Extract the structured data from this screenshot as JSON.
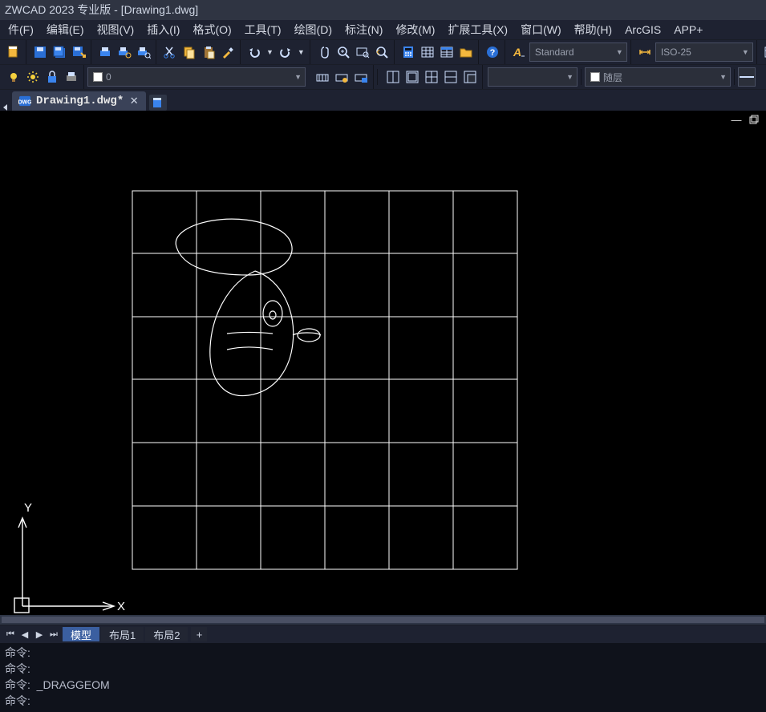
{
  "title": "ZWCAD 2023 专业版 - [Drawing1.dwg]",
  "menu": [
    "件(F)",
    "编辑(E)",
    "视图(V)",
    "插入(I)",
    "格式(O)",
    "工具(T)",
    "绘图(D)",
    "标注(N)",
    "修改(M)",
    "扩展工具(X)",
    "窗口(W)",
    "帮助(H)",
    "ArcGIS",
    "APP+"
  ],
  "textstyle": "Standard",
  "dimstyle": "ISO-25",
  "layer": "0",
  "bylayer": "随层",
  "file_tab": {
    "name": "Drawing1.dwg*"
  },
  "layout_tabs": {
    "active": "模型",
    "others": [
      "布局1",
      "布局2"
    ]
  },
  "cmd_prompt": "命令:",
  "cmd_history": [
    "命令:",
    "命令:",
    "命令:  _DRAGGEOM",
    "命令:"
  ],
  "ucs": {
    "x": "X",
    "y": "Y"
  }
}
